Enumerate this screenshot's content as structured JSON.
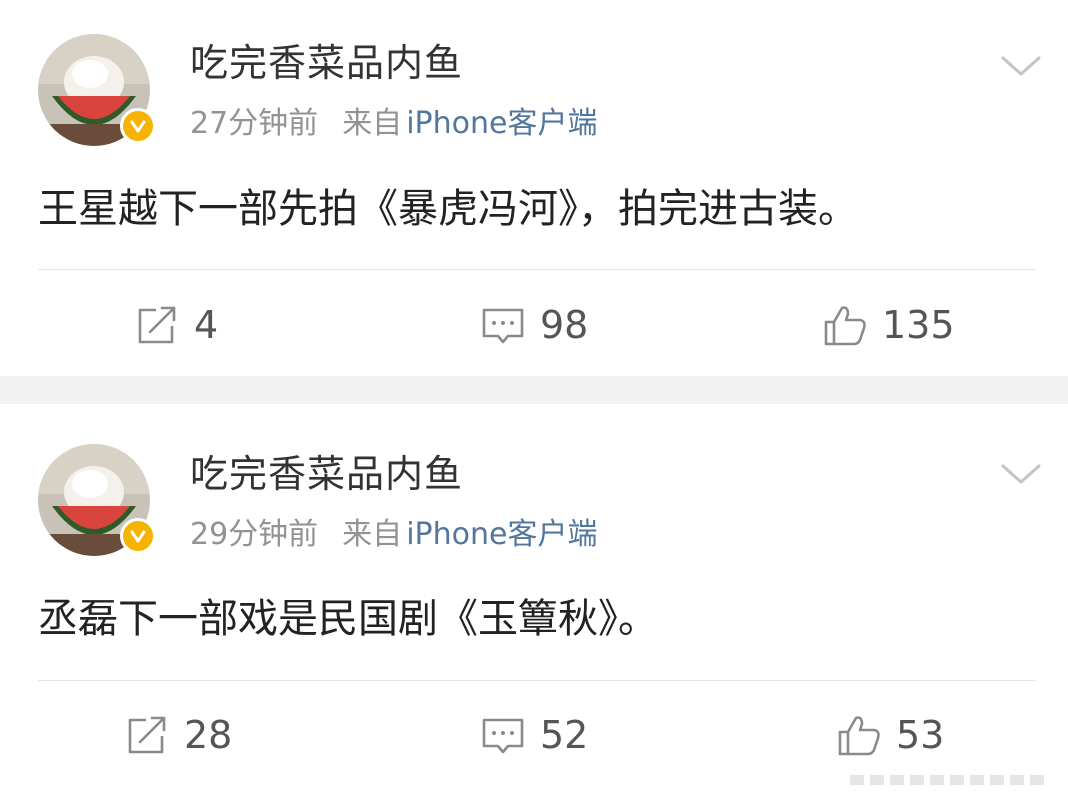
{
  "posts": [
    {
      "username": "吃完香菜品内鱼",
      "time": "27分钟前",
      "source_prefix": "来自",
      "source_name": "iPhone客户端",
      "content": "王星越下一部先拍《暴虎冯河》，拍完进古装。",
      "reposts": "4",
      "comments": "98",
      "likes": "135"
    },
    {
      "username": "吃完香菜品内鱼",
      "time": "29分钟前",
      "source_prefix": "来自",
      "source_name": "iPhone客户端",
      "content": "丞磊下一部戏是民国剧《玉簟秋》。",
      "reposts": "28",
      "comments": "52",
      "likes": "53"
    }
  ],
  "icons": {
    "more": "chevron-down-icon",
    "repost": "repost-icon",
    "comment": "comment-icon",
    "like": "thumbs-up-icon",
    "verified": "verified-badge-icon"
  },
  "colors": {
    "source_link": "#53779c",
    "verified": "#f6b400",
    "meta_text": "#939393",
    "separator": "#f2f2f2"
  }
}
